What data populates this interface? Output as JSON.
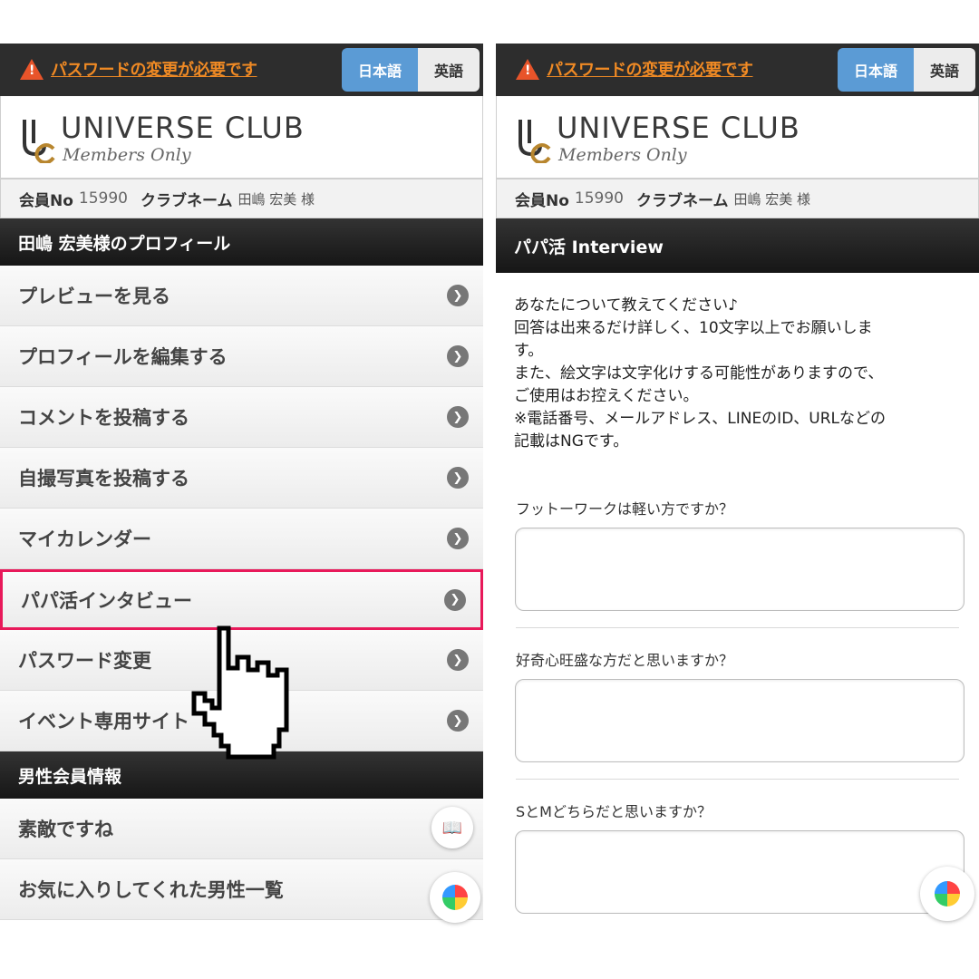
{
  "left": {
    "warning_text": "パスワードの変更が必要です",
    "lang_ja": "日本語",
    "lang_en": "英語",
    "logo_title": "UNIVERSE CLUB",
    "logo_sub": "Members Only",
    "member_label": "会員No",
    "member_no": "15990",
    "clubname_label": "クラブネーム",
    "member_name": "田嶋 宏美 様",
    "profile_section": "田嶋 宏美様のプロフィール",
    "menu": [
      {
        "label": "プレビューを見る"
      },
      {
        "label": "プロフィールを編集する"
      },
      {
        "label": "コメントを投稿する"
      },
      {
        "label": "自撮写真を投稿する"
      },
      {
        "label": "マイカレンダー"
      },
      {
        "label": "パパ活インタビュー"
      },
      {
        "label": "パスワード変更"
      },
      {
        "label": "イベント専用サイト"
      }
    ],
    "male_section": "男性会員情報",
    "male_menu": [
      {
        "label": "素敵ですね"
      },
      {
        "label": "お気に入りしてくれた男性一覧"
      }
    ]
  },
  "right": {
    "warning_text": "パスワードの変更が必要です",
    "lang_ja": "日本語",
    "lang_en": "英語",
    "logo_title": "UNIVERSE CLUB",
    "logo_sub": "Members Only",
    "member_label": "会員No",
    "member_no": "15990",
    "clubname_label": "クラブネーム",
    "member_name": "田嶋 宏美 様",
    "section": "パパ活 Interview",
    "intro": [
      "あなたについて教えてください♪",
      "回答は出来るだけ詳しく、10文字以上でお願いしま",
      "す。",
      "また、絵文字は文字化けする可能性がありますので、",
      "ご使用はお控えください。",
      "※電話番号、メールアドレス、LINEのID、URLなどの",
      "記載はNGです。"
    ],
    "questions": [
      {
        "label": "フットーワークは軽い方ですか？",
        "value": ""
      },
      {
        "label": "好奇心旺盛な方だと思いますか？",
        "value": ""
      },
      {
        "label": "SとMどちらだと思いますか？",
        "value": ""
      }
    ]
  },
  "colors": {
    "highlight": "#e8195a",
    "warning": "#f08a24",
    "lang_active": "#5b9bd5"
  }
}
